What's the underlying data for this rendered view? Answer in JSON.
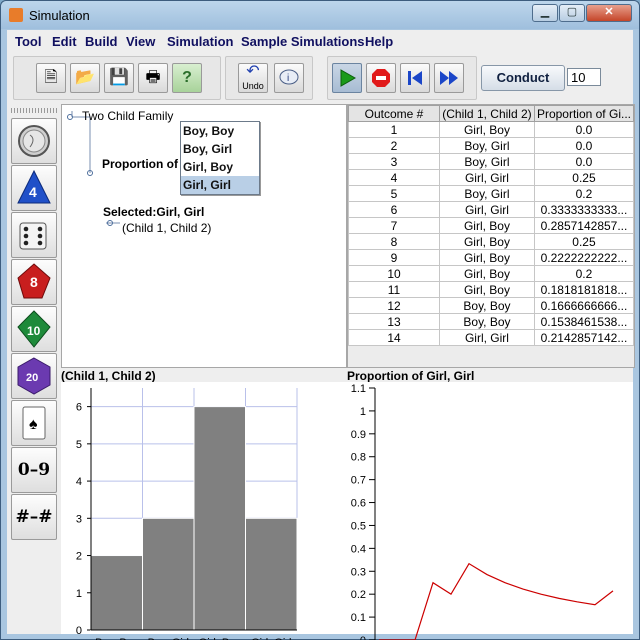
{
  "window": {
    "title": "Simulation"
  },
  "menu": [
    "Tool",
    "Edit",
    "Build",
    "View",
    "Simulation",
    "Sample Simulations",
    "Help"
  ],
  "toolbar": {
    "buttons": [
      {
        "name": "new-file-icon",
        "glyph": "🗎"
      },
      {
        "name": "open-folder-icon",
        "glyph": "📂"
      },
      {
        "name": "save-disk-icon",
        "glyph": "💾"
      },
      {
        "name": "print-icon",
        "glyph": "🖶"
      },
      {
        "name": "help-icon",
        "glyph": "?"
      }
    ],
    "undo_label": "Undo",
    "conduct_label": "Conduct",
    "trials_value": "10"
  },
  "palette": [
    {
      "name": "coin-icon",
      "label": ""
    },
    {
      "name": "d4-die-icon",
      "label": "4"
    },
    {
      "name": "six-sided-die-icon",
      "label": ""
    },
    {
      "name": "d8-die-icon",
      "label": "8"
    },
    {
      "name": "d10-die-icon",
      "label": "10"
    },
    {
      "name": "d20-die-icon",
      "label": "20"
    },
    {
      "name": "playing-card-icon",
      "label": ""
    },
    {
      "name": "digit-range-icon",
      "label": "0–9"
    },
    {
      "name": "number-range-icon",
      "label": "#–#"
    }
  ],
  "tree": {
    "root": "Two Child Family",
    "node": "Proportion of",
    "selected": "Selected:Girl, Girl",
    "leaf": "(Child 1, Child 2)",
    "popup_options": [
      "Boy, Boy",
      "Boy, Girl",
      "Girl, Boy",
      "Girl, Girl"
    ],
    "popup_selected": "Girl, Girl"
  },
  "table": {
    "headers": [
      "Outcome #",
      "(Child 1, Child 2)",
      "Proportion of Gi..."
    ],
    "rows": [
      [
        "1",
        "Girl, Boy",
        "0.0"
      ],
      [
        "2",
        "Boy, Girl",
        "0.0"
      ],
      [
        "3",
        "Boy, Girl",
        "0.0"
      ],
      [
        "4",
        "Girl, Girl",
        "0.25"
      ],
      [
        "5",
        "Boy, Girl",
        "0.2"
      ],
      [
        "6",
        "Girl, Girl",
        "0.3333333333..."
      ],
      [
        "7",
        "Girl, Boy",
        "0.2857142857..."
      ],
      [
        "8",
        "Girl, Boy",
        "0.25"
      ],
      [
        "9",
        "Girl, Boy",
        "0.2222222222..."
      ],
      [
        "10",
        "Girl, Boy",
        "0.2"
      ],
      [
        "11",
        "Girl, Boy",
        "0.1818181818..."
      ],
      [
        "12",
        "Boy, Boy",
        "0.1666666666..."
      ],
      [
        "13",
        "Boy, Boy",
        "0.1538461538..."
      ],
      [
        "14",
        "Girl, Girl",
        "0.2142857142..."
      ]
    ]
  },
  "chart_data": [
    {
      "type": "bar",
      "title": "(Child 1, Child 2)",
      "categories": [
        "Boy, Boy",
        "Boy, Girl",
        "Girl, Boy",
        "Girl, Girl"
      ],
      "values": [
        2,
        3,
        6,
        3
      ],
      "ylim": [
        0,
        6.5
      ],
      "yticks": [
        "0",
        "1",
        "2",
        "3",
        "4",
        "5",
        "6"
      ],
      "grid": true,
      "bar_color": "#808080"
    },
    {
      "type": "line",
      "title": "Proportion of Girl, Girl",
      "x": [
        1,
        2,
        3,
        4,
        5,
        6,
        7,
        8,
        9,
        10,
        11,
        12,
        13,
        14
      ],
      "values": [
        0.0,
        0.0,
        0.0,
        0.25,
        0.2,
        0.3333,
        0.2857,
        0.25,
        0.2222,
        0.2,
        0.1818,
        0.1667,
        0.1538,
        0.2143
      ],
      "ylim": [
        0,
        1.1
      ],
      "yticks": [
        "0",
        "0.1",
        "0.2",
        "0.3",
        "0.4",
        "0.5",
        "0.6",
        "0.7",
        "0.8",
        "0.9",
        "1",
        "1.1"
      ],
      "line_color": "#cc0000",
      "grid": false
    }
  ]
}
